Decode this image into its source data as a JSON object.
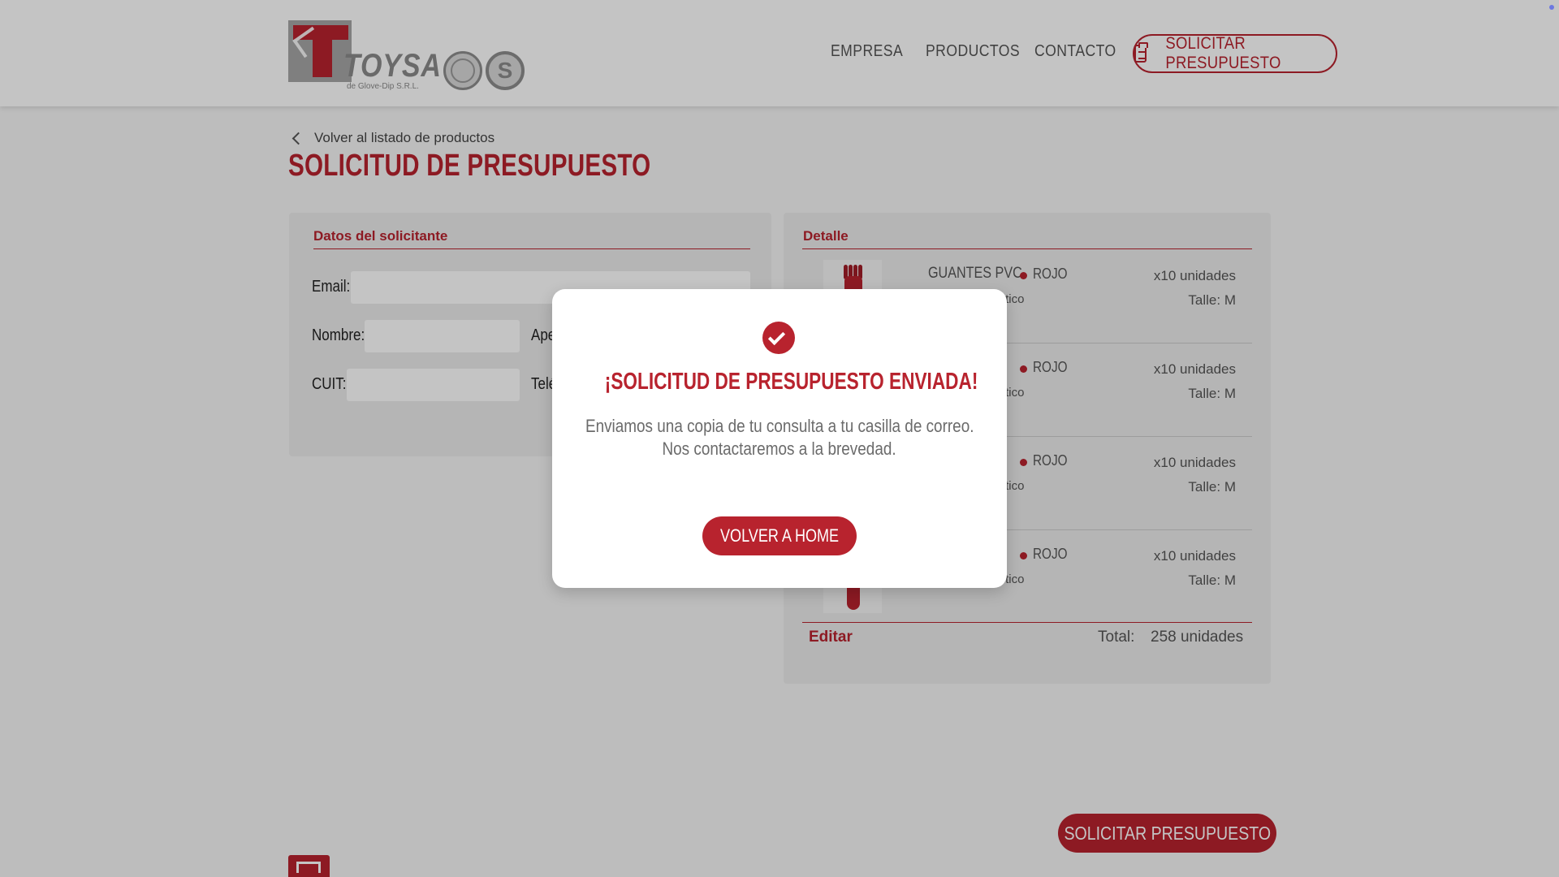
{
  "header": {
    "logo_text": "TOYSA",
    "logo_sub": "de Glove-Dip S.R.L.",
    "nav": [
      "EMPRESA",
      "PRODUCTOS",
      "CONTACTO"
    ],
    "cta_label": "SOLICITAR PRESUPUESTO"
  },
  "page": {
    "back_link": "Volver al listado de productos",
    "title": "SOLICITUD DE PRESUPUESTO"
  },
  "form": {
    "section_title": "Datos del solicitante",
    "email_label": "Email:",
    "nombre_label": "Nombre:",
    "apellido_label": "Ape",
    "cuit_label": "CUIT:",
    "telefono_label": "Telé"
  },
  "detail": {
    "section_title": "Detalle",
    "items": [
      {
        "name": "GUANTES PVC",
        "color": "ROJO",
        "sub": "Puño con elástico",
        "qty": "x10 unidades",
        "talle": "Talle: M"
      },
      {
        "name": "",
        "color": "ROJO",
        "sub": "Puño con elástico",
        "qty": "x10 unidades",
        "talle": "Talle: M"
      },
      {
        "name": "",
        "color": "ROJO",
        "sub": "Puño con elástico",
        "qty": "x10 unidades",
        "talle": "Talle: M"
      },
      {
        "name": "",
        "color": "ROJO",
        "sub": "Puño con elástico",
        "qty": "x10 unidades",
        "talle": "Talle: M"
      }
    ],
    "edit_label": "Editar",
    "total_label": "Total:",
    "total_value": "258 unidades"
  },
  "bottom_cta": "SOLICITAR PRESUPUESTO",
  "modal": {
    "title": "¡SOLICITUD DE PRESUPUESTO ENVIADA!",
    "line1": "Enviamos una copia de tu consulta a tu casilla de correo.",
    "line2": "Nos contactaremos a la brevedad.",
    "button": "VOLVER A HOME"
  },
  "colors": {
    "brand_red": "#b8232e",
    "overlay": "rgba(0,0,0,0.23)"
  },
  "icons": [
    "toysa-logo",
    "iram-seal-icon",
    "s-seal-icon",
    "clipboard-icon",
    "chevron-left-icon",
    "check-circle-icon",
    "glove-image"
  ]
}
